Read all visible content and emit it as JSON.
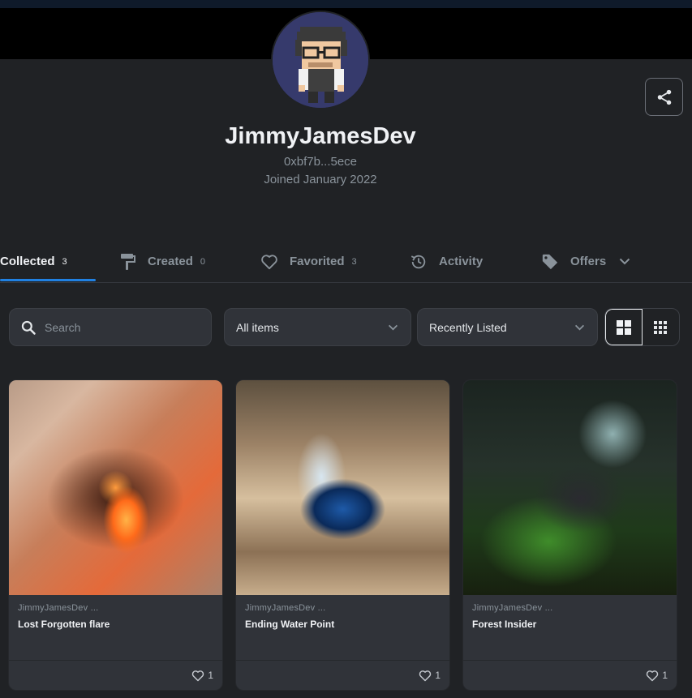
{
  "profile": {
    "name": "JimmyJamesDev",
    "address": "0xbf7b...5ece",
    "joined": "Joined January 2022"
  },
  "tabs": [
    {
      "label": "Collected",
      "count": "3",
      "icon": "grid-icon"
    },
    {
      "label": "Created",
      "count": "0",
      "icon": "paint-roller-icon"
    },
    {
      "label": "Favorited",
      "count": "3",
      "icon": "heart-icon"
    },
    {
      "label": "Activity",
      "count": "",
      "icon": "history-icon"
    },
    {
      "label": "Offers",
      "count": "",
      "icon": "tag-icon"
    }
  ],
  "filters": {
    "search_placeholder": "Search",
    "items_select": "All items",
    "sort_select": "Recently Listed"
  },
  "cards": [
    {
      "creator": "JimmyJamesDev ...",
      "title": "Lost Forgotten flare",
      "likes": "1"
    },
    {
      "creator": "JimmyJamesDev ...",
      "title": "Ending Water Point",
      "likes": "1"
    },
    {
      "creator": "JimmyJamesDev ...",
      "title": "Forest Insider",
      "likes": "1"
    }
  ],
  "colors": {
    "background": "#202225",
    "card": "#303339",
    "accent": "#2081e2"
  }
}
